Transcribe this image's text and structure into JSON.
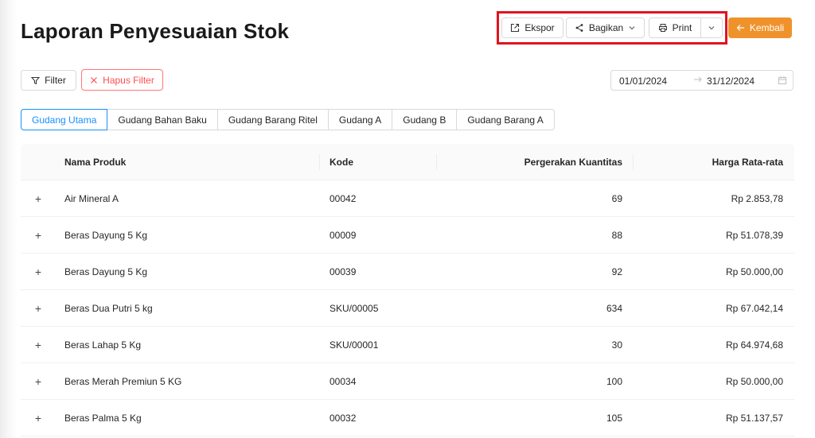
{
  "page": {
    "title": "Laporan Penyesuaian Stok"
  },
  "toolbar": {
    "export_label": "Ekspor",
    "share_label": "Bagikan",
    "print_label": "Print",
    "back_label": "Kembali",
    "back_color": "#f0922b"
  },
  "filters": {
    "filter_label": "Filter",
    "clear_label": "Hapus Filter",
    "date_start": "01/01/2024",
    "date_end": "31/12/2024"
  },
  "tabs": [
    {
      "label": "Gudang Utama",
      "active": true
    },
    {
      "label": "Gudang Bahan Baku"
    },
    {
      "label": "Gudang Barang Ritel"
    },
    {
      "label": "Gudang A"
    },
    {
      "label": "Gudang B"
    },
    {
      "label": "Gudang Barang A"
    }
  ],
  "table": {
    "headers": {
      "name": "Nama Produk",
      "code": "Kode",
      "qty": "Pergerakan Kuantitas",
      "price": "Harga Rata-rata"
    },
    "rows": [
      {
        "name": "Air Mineral A",
        "code": "00042",
        "qty": "69",
        "price": "Rp 2.853,78"
      },
      {
        "name": "Beras Dayung 5 Kg",
        "code": "00009",
        "qty": "88",
        "price": "Rp 51.078,39"
      },
      {
        "name": "Beras Dayung 5 Kg",
        "code": "00039",
        "qty": "92",
        "price": "Rp 50.000,00"
      },
      {
        "name": "Beras Dua Putri 5 kg",
        "code": "SKU/00005",
        "qty": "634",
        "price": "Rp 67.042,14"
      },
      {
        "name": "Beras Lahap 5 Kg",
        "code": "SKU/00001",
        "qty": "30",
        "price": "Rp 64.974,68"
      },
      {
        "name": "Beras Merah Premiun 5 KG",
        "code": "00034",
        "qty": "100",
        "price": "Rp 50.000,00"
      },
      {
        "name": "Beras Palma 5 Kg",
        "code": "00032",
        "qty": "105",
        "price": "Rp 51.137,57"
      }
    ]
  }
}
